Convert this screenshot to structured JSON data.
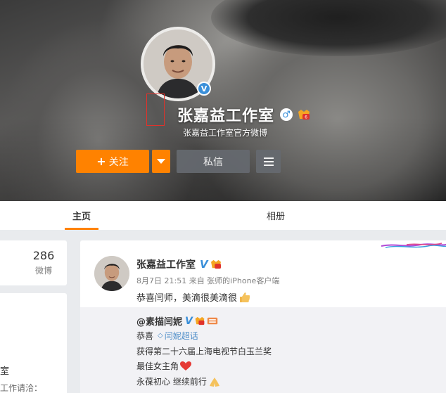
{
  "profile": {
    "name": "张嘉益工作室",
    "subtitle": "张嘉益工作室官方微博",
    "gender_symbol": "♂",
    "verified_symbol": "V"
  },
  "actions": {
    "follow_plus": "+",
    "follow_label": "关注",
    "message_label": "私信"
  },
  "tabs": [
    {
      "label": "主页",
      "active": true
    },
    {
      "label": "相册",
      "active": false
    }
  ],
  "stats": {
    "count": "286",
    "label": "微博"
  },
  "left_snippets": {
    "line1": "室",
    "line2": "工作请洽："
  },
  "post": {
    "author": "张嘉益工作室",
    "verified_symbol": "V",
    "meta": "8月7日 21:51 来自 张师的iPhone客户端",
    "text": "恭喜闫师，美滴很美滴很",
    "repost": {
      "author": "@素描闫妮",
      "verified_symbol": "V",
      "line1_prefix": "恭喜",
      "topic": "闫妮超话",
      "line2": "获得第二十六届上海电视节白玉兰奖",
      "line3": "最佳女主角",
      "line4": "永葆初心 继续前行"
    }
  },
  "colors": {
    "accent": "#ff8200",
    "verified_blue": "#3a8fd9",
    "link_blue": "#4a8bc7",
    "button_gray": "#666a70"
  },
  "icons": {
    "follow": "plus-icon",
    "dropdown": "caret-down-icon",
    "more": "menu-icon",
    "gender": "male-icon",
    "verified": "verified-icon",
    "vip": "vip-badge-icon"
  }
}
